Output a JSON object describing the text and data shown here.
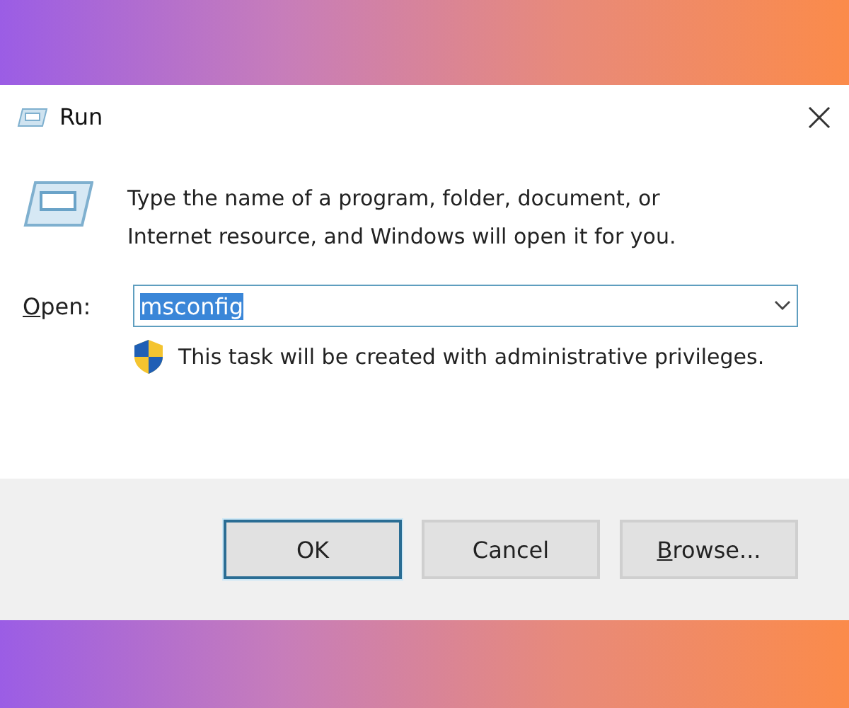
{
  "window": {
    "title": "Run"
  },
  "description": "Type the name of a program, folder, document, or Internet resource, and Windows will open it for you.",
  "open_field": {
    "label": "Open:",
    "label_access_key_first": true,
    "value": "msconfig",
    "text_selected": true
  },
  "notice": "This task will be created with administrative privileges.",
  "buttons": [
    {
      "label": "OK",
      "default": true,
      "access_key_first": false
    },
    {
      "label": "Cancel",
      "default": false,
      "access_key_first": false
    },
    {
      "label": "Browse...",
      "default": false,
      "access_key_first": true
    }
  ]
}
